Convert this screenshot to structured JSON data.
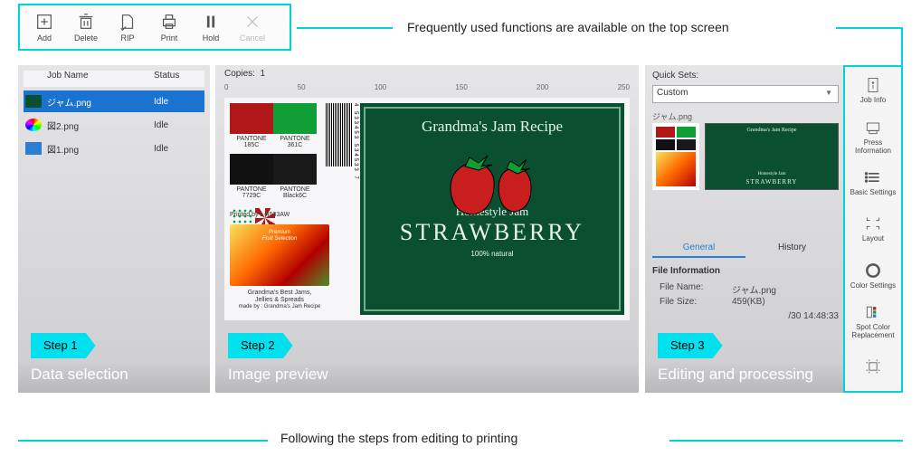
{
  "callouts": {
    "top": "Frequently used functions  are available on the top screen",
    "bottom": "Following the steps from editing to printing"
  },
  "toolbar": [
    {
      "name": "add-button",
      "label": "Add",
      "icon": "add",
      "enabled": true
    },
    {
      "name": "delete-button",
      "label": "Delete",
      "icon": "trash",
      "enabled": true
    },
    {
      "name": "rip-button",
      "label": "RIP",
      "icon": "rip",
      "enabled": true
    },
    {
      "name": "print-button",
      "label": "Print",
      "icon": "print",
      "enabled": true
    },
    {
      "name": "hold-button",
      "label": "Hold",
      "icon": "pause",
      "enabled": true
    },
    {
      "name": "cancel-button",
      "label": "Cancel",
      "icon": "close",
      "enabled": false
    }
  ],
  "steps": [
    {
      "tag": "Step 1",
      "title": "Data selection"
    },
    {
      "tag": "Step 2",
      "title": "Image preview"
    },
    {
      "tag": "Step 3",
      "title": "Editing and processing"
    }
  ],
  "job_list": {
    "columns": [
      "",
      "Job Name",
      "Status"
    ],
    "rows": [
      {
        "name": "ジャム.png",
        "status": "Idle",
        "selected": true,
        "thumb": "#0b4f31"
      },
      {
        "name": "図2.png",
        "status": "Idle",
        "selected": false,
        "thumb": "conic"
      },
      {
        "name": "図1.png",
        "status": "Idle",
        "selected": false,
        "thumb": "#2a7dd1"
      }
    ]
  },
  "preview": {
    "copies_label": "Copies:",
    "copies_value": "1",
    "ruler": [
      "0",
      "50",
      "100",
      "150",
      "200",
      "250"
    ],
    "swatches": [
      {
        "color": "#b01818",
        "label": "PANTONE 185C"
      },
      {
        "color": "#0f9f36",
        "label": "PANTONE 361C"
      },
      {
        "color": "#111111",
        "label": "PANTONE 7729C"
      },
      {
        "color": "#1a1a1a",
        "label": "PANTONE Black6C"
      }
    ],
    "barcode_nums": "4 533453 534533 7",
    "printed_by": "Printed by L-4533AW",
    "fruit_banner_l1": "Premium",
    "fruit_banner_l2": "Fruit Selection",
    "fruit_caption_l1": "Grandma's Best Jams,",
    "fruit_caption_l2": "Jellies & Spreads",
    "fruit_caption_l3": "made by : Grandma's Jam Recipe",
    "label": {
      "title": "Grandma's Jam Recipe",
      "sub": "Homestyle Jam",
      "big": "STRAWBERRY",
      "small": "100% natural"
    }
  },
  "edit": {
    "quick_sets_label": "Quick Sets:",
    "quick_sets_value": "Custom",
    "file": "ジャム.png",
    "tabs": [
      "General",
      "History"
    ],
    "active_tab": 0,
    "file_info_header": "File Information",
    "kv": [
      {
        "k": "File Name:",
        "v": "ジャム.png"
      },
      {
        "k": "File Size:",
        "v": "459(KB)"
      },
      {
        "k": "",
        "v": "/30 14:48:33"
      }
    ]
  },
  "side": [
    {
      "name": "job-info-button",
      "label": "Job Info",
      "icon": "page-i"
    },
    {
      "name": "press-info-button",
      "label": "Press Information",
      "icon": "press"
    },
    {
      "name": "basic-settings-button",
      "label": "Basic Settings",
      "icon": "list"
    },
    {
      "name": "layout-button",
      "label": "Layout",
      "icon": "crop"
    },
    {
      "name": "color-settings-button",
      "label": "Color Settings",
      "icon": "circle"
    },
    {
      "name": "spot-color-button",
      "label": "Spot Color Replacement",
      "icon": "spot"
    },
    {
      "name": "crop-marks-button",
      "label": "",
      "icon": "marks"
    }
  ]
}
